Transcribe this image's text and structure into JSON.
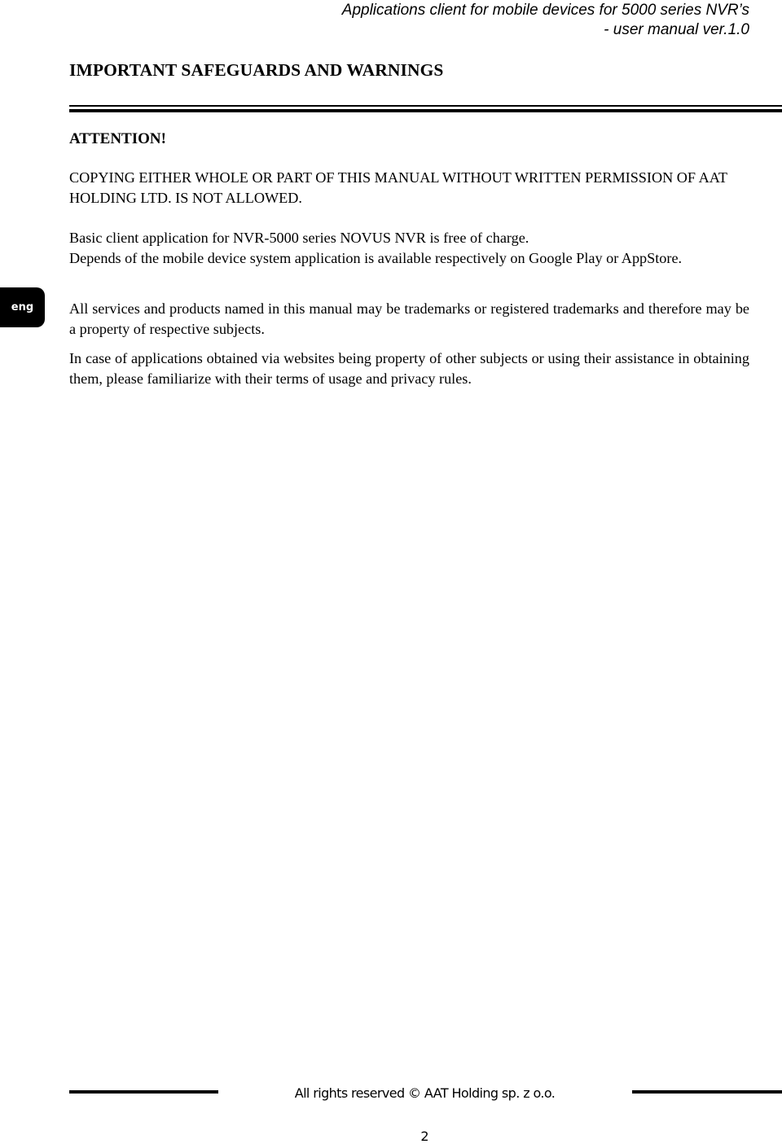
{
  "header": {
    "line1": "Applications client for mobile devices for 5000 series NVR’s",
    "line2": "- user manual ver.1.0"
  },
  "title": "IMPORTANT SAFEGUARDS AND WARNINGS",
  "side_tab": {
    "label": "eng"
  },
  "attention": "ATTENTION!",
  "paragraphs": {
    "copying": "COPYING EITHER WHOLE OR PART OF THIS MANUAL WITHOUT WRITTEN PERMISSION OF AAT HOLDING LTD. IS NOT ALLOWED.",
    "basic_line1": "Basic client application for NVR-5000 series NOVUS NVR is free of charge.",
    "basic_line2": "Depends of the mobile device system application is available respectively on Google Play or AppStore.",
    "trademarks": "All services and products named in this manual may be trademarks or registered trademarks and therefore may be a property of respective subjects.",
    "third_party": "In case of applications obtained via websites being property of other subjects or using their assistance in obtaining them, please familiarize with their terms of usage and privacy rules."
  },
  "footer": {
    "copyright": "All rights reserved © AAT Holding sp. z o.o.",
    "page_number": "2"
  }
}
